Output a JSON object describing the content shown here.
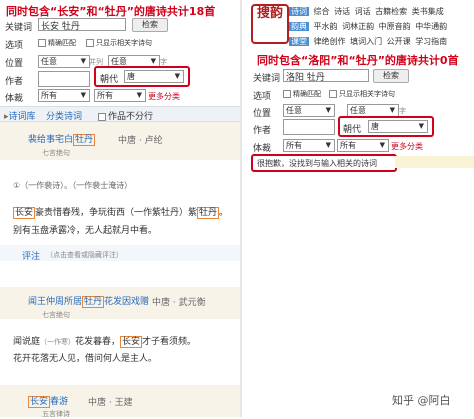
{
  "left": {
    "headline": "同时包含“长安”和“牡丹”的唐诗共计18首",
    "form": {
      "keyword_label": "关键词",
      "keyword_value": "长安 牡丹",
      "search_btn": "检索",
      "option_label": "选项",
      "opt_exact": "精确匹配",
      "opt_related": "只显示相关字诗句",
      "position_label": "位置",
      "position_value": "任意",
      "position_value2": "任意",
      "author_label": "作者",
      "dynasty_label": "朝代",
      "dynasty_value": "唐",
      "genre_label": "体裁",
      "genre_value": "所有",
      "genre_value2": "所有",
      "more_link": "更多分类",
      "combine": "并列",
      "sub": "字"
    },
    "tabs": {
      "t1": "诗词库",
      "t2": "分类诗词",
      "t3": "作品不分行"
    },
    "poem1": {
      "title_a": "裴给事宅白",
      "title_b": "牡丹",
      "meta": "中唐 · 卢纶",
      "form": "七言绝句",
      "note": "①（一作裴诗）。（一作裴士淹诗）",
      "l1a": "长安",
      "l1b": "豪贵惜春残，争玩街西（一作紫牡丹）紫",
      "l1c": "牡丹",
      "l1d": "。",
      "l2": "别有玉盘承露冷，无人起就月中看。",
      "comment": "评注",
      "comment_hint": "（点击查看或隐藏评注）"
    },
    "poem2": {
      "title_a": "闻王仲周所居",
      "title_b": "牡丹",
      "title_c": "花发因戏赠",
      "meta": "中唐 · 武元衡",
      "form": "七言绝句",
      "l1a": "闻说庭",
      "l1b": "（一作寒）",
      "l1c": "花发暮春，",
      "l1d": "长安",
      "l1e": "才子看须频。",
      "l2": "花开花落无人见，借问何人是主人。"
    },
    "poem3": {
      "title_a": "长安",
      "title_b": "春游",
      "meta": "中唐 · 王建",
      "form": "五言律诗"
    }
  },
  "right": {
    "logo_text": "搜韵",
    "nav": [
      [
        "诗词",
        "综合",
        "诗话",
        "词话",
        "古籍检索",
        "类书集成"
      ],
      [
        "韵典",
        "平水韵",
        "词林正韵",
        "中原音韵",
        "中华通韵"
      ],
      [
        "课堂",
        "律绝创作",
        "填词入门",
        "公开课",
        "学习指南"
      ]
    ],
    "headline": "同时包含“洛阳”和“牡丹”的唐诗共计0首",
    "form": {
      "keyword_label": "关键词",
      "keyword_value": "洛阳 牡丹",
      "search_btn": "检索",
      "option_label": "选项",
      "opt_exact": "精确匹配",
      "opt_related": "只显示相关字诗句",
      "position_label": "位置",
      "position_value": "任意",
      "position_value2": "任意",
      "author_label": "作者",
      "dynasty_label": "朝代",
      "dynasty_value": "唐",
      "genre_label": "体裁",
      "genre_value": "所有",
      "genre_value2": "所有",
      "more_link": "更多分类",
      "sub": "字"
    },
    "no_result": "很抱歉，没找到与输入相关的诗词"
  },
  "watermark": "知乎 @阿白"
}
